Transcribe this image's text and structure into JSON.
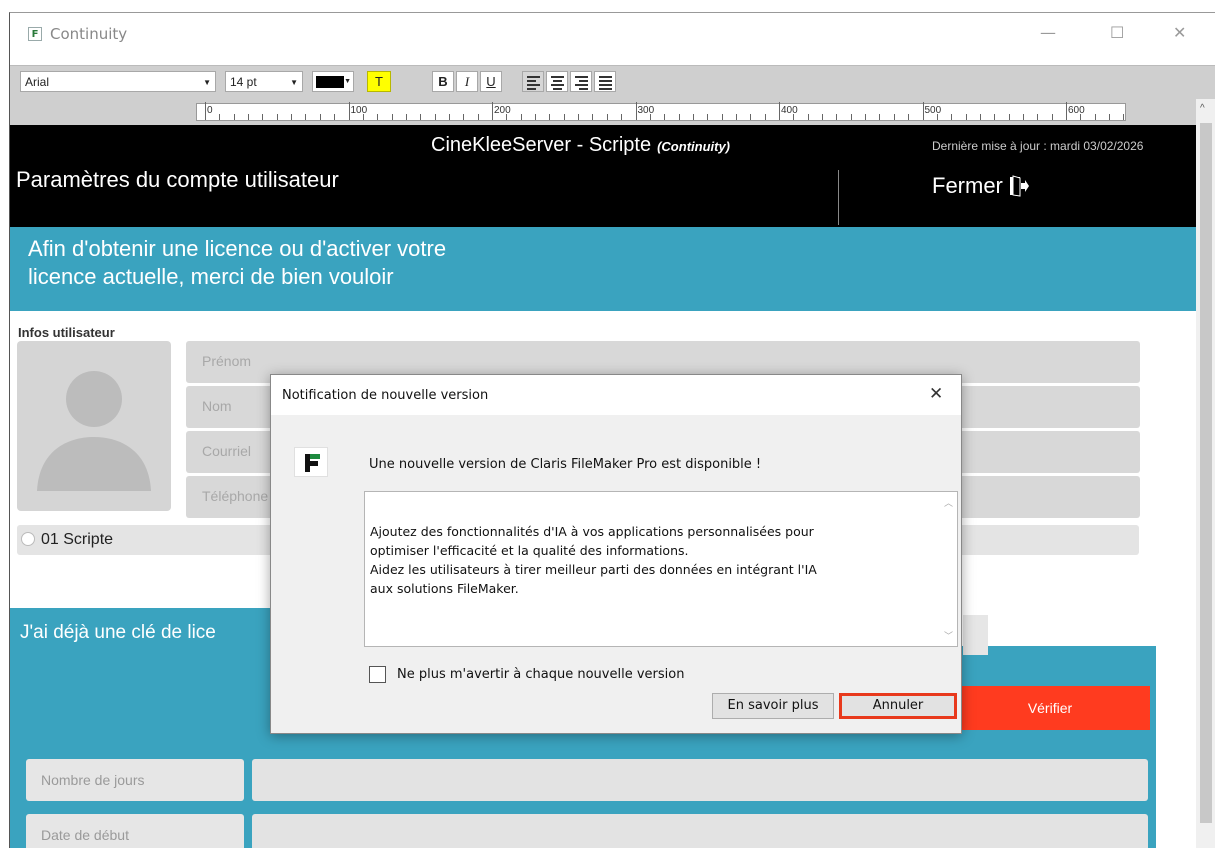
{
  "window": {
    "title": "Continuity"
  },
  "format_bar": {
    "font": "Arial",
    "size": "14 pt",
    "text_color": "#000000",
    "highlight_glyph": "T",
    "bold": "B",
    "italic": "I",
    "underline": "U"
  },
  "ruler": {
    "labels": [
      "0",
      "100",
      "200",
      "300",
      "400",
      "500",
      "600"
    ]
  },
  "header": {
    "server_title": "CineKleeServer - Scripte",
    "server_subtitle": "(Continuity)",
    "last_update": "Dernière mise à jour : mardi 03/02/2026",
    "page_title": "Paramètres du compte utilisateur",
    "close_label": "Fermer"
  },
  "banner": {
    "line1": "Afin d'obtenir une licence ou d'activer votre",
    "line2": "licence actuelle, merci de bien vouloir"
  },
  "user_info": {
    "section_label": "Infos utilisateur",
    "fields": [
      "Prénom",
      "Nom",
      "Courriel",
      "Téléphone"
    ],
    "role": "01  Scripte"
  },
  "license": {
    "title": "J'ai déjà une clé de lice",
    "verify_label": "Vérifier",
    "fields": [
      "Nombre de jours",
      "Date de début"
    ]
  },
  "dialog": {
    "title": "Notification de nouvelle version",
    "message": "Une nouvelle version de Claris FileMaker Pro est disponible !",
    "details": "Ajoutez des fonctionnalités d'IA à vos applications personnalisées pour\noptimiser l'efficacité et la qualité des informations.\nAidez les utilisateurs à tirer meilleur parti des données en intégrant l'IA\naux solutions FileMaker.",
    "checkbox_label": "Ne plus m'avertir à chaque nouvelle version",
    "learn_more_label": "En savoir plus",
    "cancel_label": "Annuler"
  },
  "colors": {
    "accent": "#3aa3bf",
    "verify": "#ff3b1f",
    "highlight": "#ffff00",
    "focus_ring": "#e8391c"
  }
}
